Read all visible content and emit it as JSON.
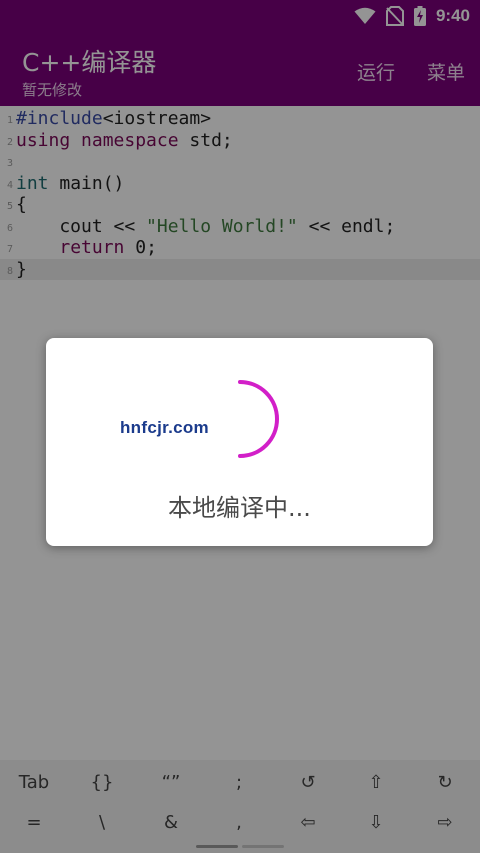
{
  "status_bar": {
    "time": "9:40"
  },
  "app_bar": {
    "title": "C++编译器",
    "subtitle": "暂无修改",
    "actions": {
      "run": "运行",
      "menu": "菜单"
    },
    "accent": "#7a007a"
  },
  "editor": {
    "lines": [
      {
        "num": "1",
        "tokens": [
          {
            "t": "#include",
            "c": "pre"
          },
          {
            "t": "<iostream>",
            "c": "plain"
          }
        ]
      },
      {
        "num": "2",
        "tokens": [
          {
            "t": "using namespace",
            "c": "kw"
          },
          {
            "t": " std;",
            "c": "plain"
          }
        ]
      },
      {
        "num": "3",
        "tokens": []
      },
      {
        "num": "4",
        "tokens": [
          {
            "t": "int",
            "c": "type"
          },
          {
            "t": " main()",
            "c": "plain"
          }
        ]
      },
      {
        "num": "5",
        "tokens": [
          {
            "t": "{",
            "c": "plain"
          }
        ]
      },
      {
        "num": "6",
        "tokens": [
          {
            "t": "    cout << ",
            "c": "plain"
          },
          {
            "t": "\"Hello World!\"",
            "c": "str"
          },
          {
            "t": " << endl;",
            "c": "plain"
          }
        ]
      },
      {
        "num": "7",
        "tokens": [
          {
            "t": "    ",
            "c": "plain"
          },
          {
            "t": "return",
            "c": "kw"
          },
          {
            "t": " 0;",
            "c": "plain"
          }
        ]
      },
      {
        "num": "8",
        "tokens": [
          {
            "t": "}",
            "c": "plain"
          }
        ]
      }
    ],
    "current_line": "8"
  },
  "dialog": {
    "message": "本地编译中...",
    "watermark": "hnfcjr.com",
    "spinner_color": "#d21fc8"
  },
  "keyboard_bar": {
    "row1": [
      "Tab",
      "{}",
      "“”",
      ";",
      "↺",
      "⇧",
      "↻"
    ],
    "row2": [
      "=",
      "\\",
      "&",
      ",",
      "⇦",
      "⇩",
      "⇨"
    ]
  }
}
